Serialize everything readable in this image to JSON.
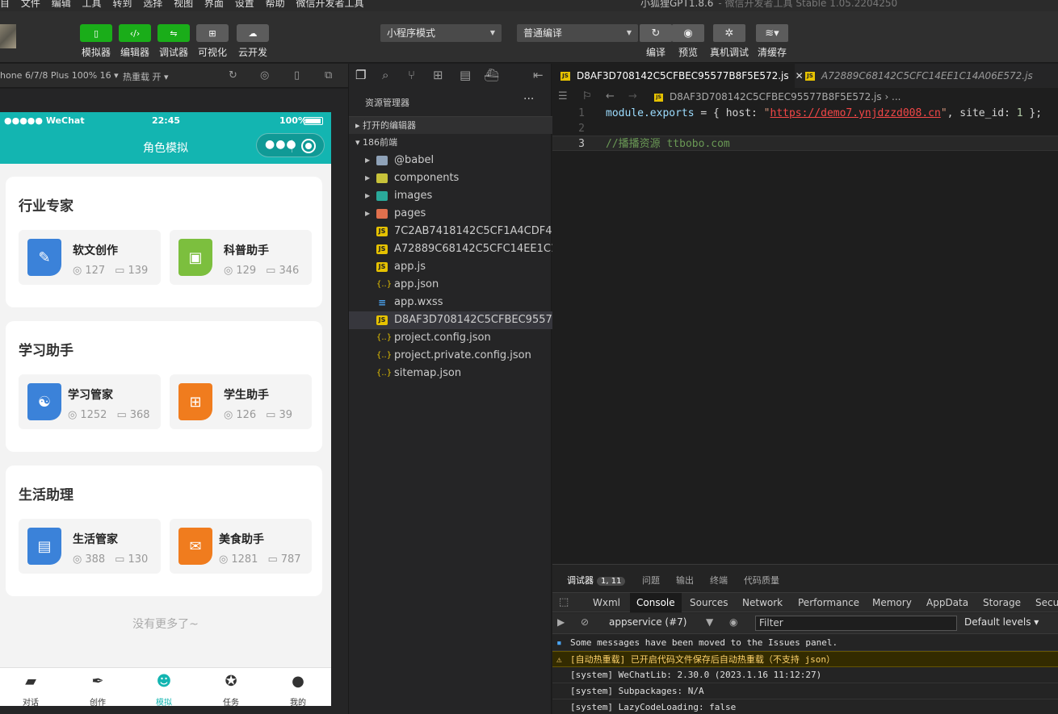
{
  "window": {
    "menu": [
      "目",
      "文件",
      "编辑",
      "工具",
      "转到",
      "选择",
      "视图",
      "界面",
      "设置",
      "帮助",
      "微信开发者工具"
    ],
    "title": "小狐狸GPT1.8.6",
    "subtitle": "- 微信开发者工具 Stable 1.05.2204250"
  },
  "toolbar": {
    "buttons": [
      {
        "label": "模拟器",
        "icon": "phone-icon"
      },
      {
        "label": "编辑器",
        "icon": "code-icon"
      },
      {
        "label": "调试器",
        "icon": "debug-icon"
      },
      {
        "label": "可视化",
        "icon": "layout-icon"
      },
      {
        "label": "云开发",
        "icon": "cloud-icon"
      }
    ],
    "mode_select": "小程序模式",
    "compile_select": "普通编译",
    "actions": [
      {
        "label": "编译",
        "icon": "refresh-icon"
      },
      {
        "label": "预览",
        "icon": "eye-icon"
      },
      {
        "label": "真机调试",
        "icon": "bug-icon"
      },
      {
        "label": "清缓存",
        "icon": "layers-icon"
      }
    ]
  },
  "simulator": {
    "device": "hone 6/7/8 Plus 100% 16 ▾",
    "hot_reload": "热重载 开 ▾"
  },
  "phone": {
    "carrier": "●●●●● WeChat",
    "time": "22:45",
    "battery": "100%",
    "nav_title": "角色模拟",
    "sections": [
      {
        "title": "行业专家",
        "cards": [
          {
            "name": "软文创作",
            "views": "127",
            "comments": "139",
            "color": "#3b82d9",
            "glyph": "✎"
          },
          {
            "name": "科普助手",
            "views": "129",
            "comments": "346",
            "color": "#7cbf3e",
            "glyph": "▣"
          }
        ]
      },
      {
        "title": "学习助手",
        "cards": [
          {
            "name": "学习管家",
            "views": "1252",
            "comments": "368",
            "color": "#3b82d9",
            "glyph": "☯"
          },
          {
            "name": "学生助手",
            "views": "126",
            "comments": "39",
            "color": "#f07c1e",
            "glyph": "⊞"
          }
        ]
      },
      {
        "title": "生活助理",
        "cards": [
          {
            "name": "生活管家",
            "views": "388",
            "comments": "130",
            "color": "#3b82d9",
            "glyph": "▤"
          },
          {
            "name": "美食助手",
            "views": "1281",
            "comments": "787",
            "color": "#f07c1e",
            "glyph": "✉"
          }
        ]
      }
    ],
    "no_more": "没有更多了~",
    "tabs": [
      {
        "label": "对话",
        "icon": "chat-icon"
      },
      {
        "label": "创作",
        "icon": "feather-icon"
      },
      {
        "label": "模拟",
        "icon": "role-icon"
      },
      {
        "label": "任务",
        "icon": "badge-icon"
      },
      {
        "label": "我的",
        "icon": "user-icon"
      }
    ],
    "accent": "#13b5b1"
  },
  "explorer": {
    "header": "资源管理器",
    "open_editors": "打开的编辑器",
    "project": "186前端",
    "items": [
      {
        "name": "@babel",
        "type": "folder"
      },
      {
        "name": "components",
        "type": "folder-y"
      },
      {
        "name": "images",
        "type": "folder-t"
      },
      {
        "name": "pages",
        "type": "folder-r"
      },
      {
        "name": "7C2AB7418142C5CF1A4CDF464...",
        "type": "js"
      },
      {
        "name": "A72889C68142C5CFC14EE1C14...",
        "type": "js"
      },
      {
        "name": "app.js",
        "type": "js"
      },
      {
        "name": "app.json",
        "type": "json"
      },
      {
        "name": "app.wxss",
        "type": "css"
      },
      {
        "name": "D8AF3D708142C5CFBEC95577B...",
        "type": "js"
      },
      {
        "name": "project.config.json",
        "type": "json"
      },
      {
        "name": "project.private.config.json",
        "type": "json"
      },
      {
        "name": "sitemap.json",
        "type": "json"
      }
    ]
  },
  "editor": {
    "tabs": [
      {
        "name": "D8AF3D708142C5CFBEC95577B8F5E572.js",
        "close": "✕"
      },
      {
        "name": "A72889C68142C5CFC14EE1C14A06E572.js"
      }
    ],
    "breadcrumb": "D8AF3D708142C5CFBEC95577B8F5E572.js › ...",
    "lines": [
      {
        "num": "1",
        "kw": "module.exports",
        "p1": " = { host: ",
        "q1": "\"",
        "url": "https://demo7.ynjdzzd008.cn",
        "q2": "\"",
        "p2": ", site_id: ",
        "num_val": "1",
        "p3": " };"
      },
      {
        "num": "2"
      },
      {
        "num": "3",
        "comment": "//播播资源 ttbobo.com"
      }
    ]
  },
  "debugger": {
    "tabs": [
      {
        "label": "调试器",
        "badge": "1, 11"
      },
      {
        "label": "问题"
      },
      {
        "label": "输出"
      },
      {
        "label": "终端"
      },
      {
        "label": "代码质量"
      }
    ],
    "console_tabs": [
      "Wxml",
      "Console",
      "Sources",
      "Network",
      "Performance",
      "Memory",
      "AppData",
      "Storage",
      "Secur"
    ],
    "context": "appservice (#7)",
    "filter_placeholder": "Filter",
    "levels": "Default levels ▾",
    "logs": [
      {
        "text": "Some messages have been moved to the Issues panel.",
        "kind": "info"
      },
      {
        "text": "[自动热重载] 已开启代码文件保存后自动热重载（不支持 json）",
        "kind": "warn"
      },
      {
        "text": "[system] WeChatLib: 2.30.0 (2023.1.16 11:12:27)",
        "kind": "normal"
      },
      {
        "text": "[system] Subpackages: N/A",
        "kind": "normal"
      },
      {
        "text": "[system] LazyCodeLoading: false",
        "kind": "normal"
      }
    ]
  }
}
